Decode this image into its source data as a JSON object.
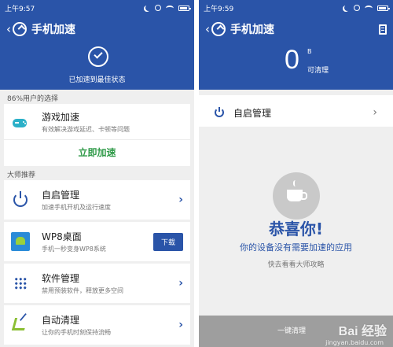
{
  "left": {
    "status_time": "上午9:57",
    "title": "手机加速",
    "hero_text": "已加速到最佳状态",
    "section_users": "86%用户的选择",
    "game": {
      "name": "游戏加速",
      "desc": "有效解决游戏延迟、卡顿等问题",
      "action": "立即加速"
    },
    "section_master": "大师推荐",
    "items": [
      {
        "name": "自启管理",
        "desc": "加速手机开机及运行速度"
      },
      {
        "name": "WP8桌面",
        "desc": "手机一秒变身WP8系统",
        "button": "下载"
      },
      {
        "name": "软件管理",
        "desc": "禁用预装软件，释放更多空间"
      },
      {
        "name": "自动清理",
        "desc": "让你的手机时刻保持流畅"
      }
    ]
  },
  "right": {
    "status_time": "上午9:59",
    "title": "手机加速",
    "big_value": "0",
    "unit": "B",
    "cleanable": "可清理",
    "auto_start": "自启管理",
    "congrats": "恭喜你!",
    "no_need": "你的设备没有需要加速的应用",
    "check_guide": "快去看看大师攻略",
    "button": "一键清理",
    "watermark": "Bai 经验",
    "watermark_url": "jingyan.baidu.com"
  },
  "colors": {
    "primary": "#2a54a8",
    "accent_green": "#2f9a48",
    "background": "#efefef"
  },
  "icons": [
    "back-chevron-icon",
    "rocket-icon",
    "check-circle-icon",
    "gamepad-icon",
    "power-icon",
    "android-icon",
    "grid-icon",
    "broom-icon",
    "cup-icon",
    "document-icon"
  ]
}
